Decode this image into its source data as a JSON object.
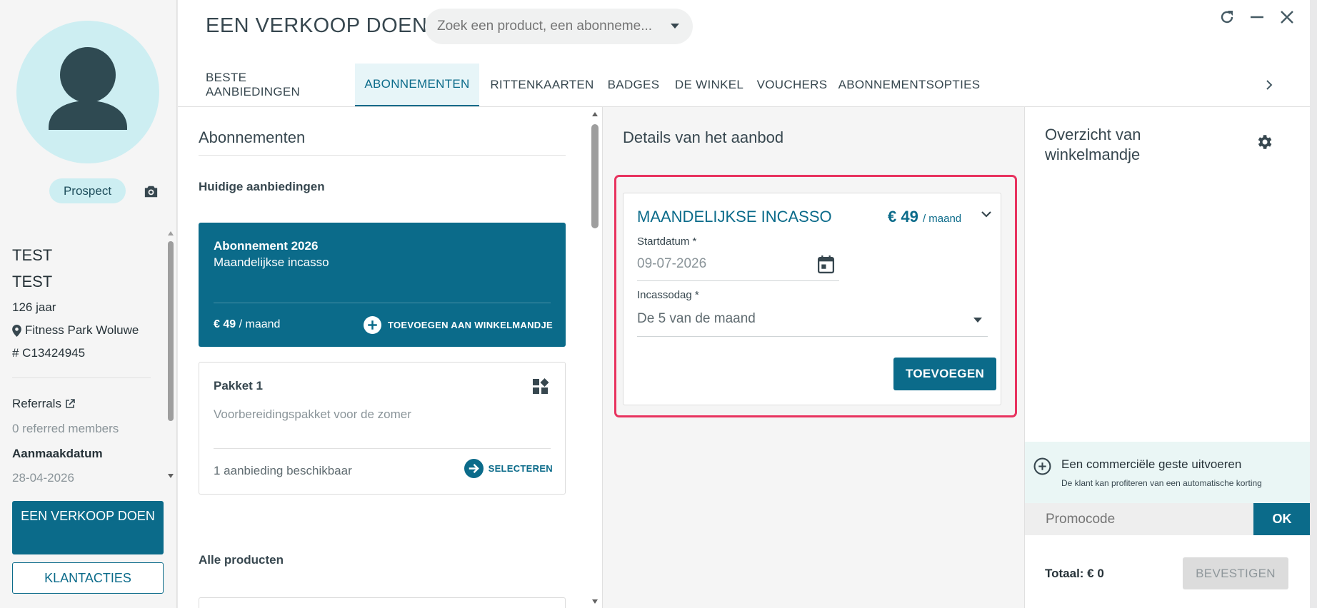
{
  "customer": {
    "status": "Prospect",
    "first_name": "TEST",
    "last_name": "TEST",
    "age": "126 jaar",
    "club": "Fitness Park Woluwe",
    "id": "# C13424945",
    "referrals_label": "Referrals",
    "referred_members": "0 referred members",
    "created_label": "Aanmaakdatum",
    "created_date": "28-04-2026",
    "sell_button": "EEN VERKOOP DOEN",
    "actions_button": "KLANTACTIES"
  },
  "dialog": {
    "title": "EEN VERKOOP DOEN",
    "search_placeholder": "Zoek een product, een abonneme...",
    "tabs": [
      {
        "label": "BESTE AANBIEDINGEN"
      },
      {
        "label": "ABONNEMENTEN"
      },
      {
        "label": "RITTENKAARTEN"
      },
      {
        "label": "BADGES"
      },
      {
        "label": "DE WINKEL"
      },
      {
        "label": "VOUCHERS"
      },
      {
        "label": "ABONNEMENTSOPTIES"
      }
    ],
    "active_tab": "ABONNEMENTEN"
  },
  "subscriptions": {
    "title": "Abonnementen",
    "current_offers_label": "Huidige aanbiedingen",
    "offer": {
      "name": "Abonnement 2026",
      "subtitle": "Maandelijkse incasso",
      "price": "€ 49",
      "period": "/ maand",
      "add_label": "TOEVOEGEN AAN WINKELMANDJE"
    },
    "package": {
      "name": "Pakket 1",
      "description": "Voorbereidingspakket voor de zomer",
      "availability": "1 aanbieding beschikbaar",
      "select_label": "SELECTEREN"
    },
    "all_products_label": "Alle producten"
  },
  "details": {
    "title": "Details van het aanbod",
    "offer_title": "MAANDELIJKSE INCASSO",
    "price": "€ 49",
    "period": "/ maand",
    "start_label": "Startdatum *",
    "start_value": "09-07-2026",
    "day_label": "Incassodag *",
    "day_value": "De 5 van de maand",
    "add_button": "TOEVOEGEN",
    "highlight_color": "#e8335f"
  },
  "cart": {
    "title": "Overzicht van winkelmandje",
    "gesture_title": "Een commerciële geste uitvoeren",
    "gesture_sub": "De klant kan profiteren van een automatische korting",
    "promo_placeholder": "Promocode",
    "ok_button": "OK",
    "total": "Totaal: € 0",
    "confirm_button": "BEVESTIGEN"
  },
  "colors": {
    "primary": "#0b6b8a",
    "accent_light": "#cdeef2",
    "highlight": "#e8335f"
  }
}
